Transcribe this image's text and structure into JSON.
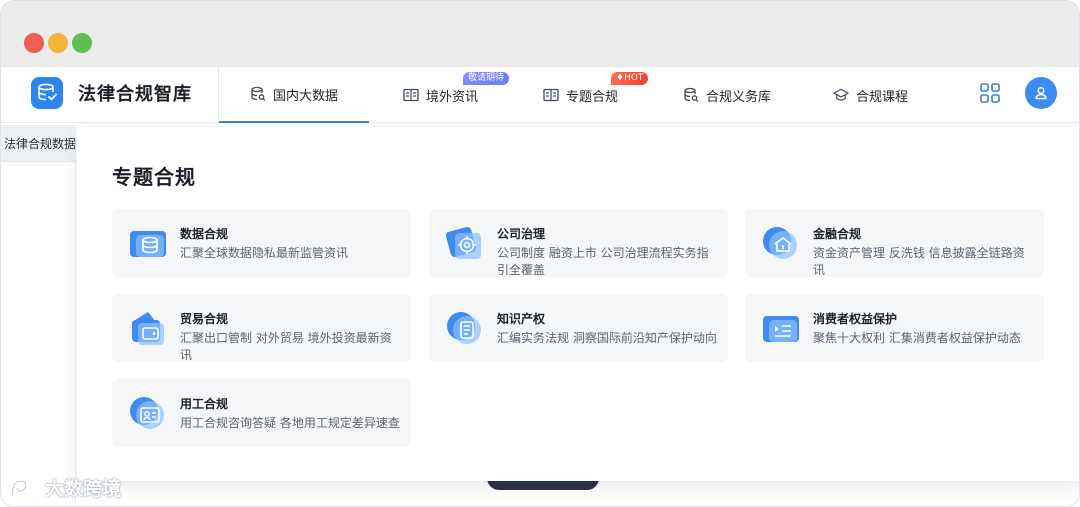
{
  "app": {
    "title": "法律合规智库"
  },
  "nav": {
    "tabs": [
      {
        "label": "国内大数据",
        "icon": "database-search-icon",
        "active": true
      },
      {
        "label": "境外资讯",
        "icon": "book-icon",
        "badge": "敬请期待"
      },
      {
        "label": "专题合规",
        "icon": "book-icon",
        "badge": "HOT"
      },
      {
        "label": "合规义务库",
        "icon": "database-search-icon"
      },
      {
        "label": "合规课程",
        "icon": "graduation-cap-icon"
      }
    ]
  },
  "sidebar": {
    "active_item": "法律合规数据"
  },
  "dropdown": {
    "title": "专题合规",
    "cards": [
      {
        "title": "数据合规",
        "desc": "汇聚全球数据隐私最新监管资讯",
        "icon": "database-icon"
      },
      {
        "title": "公司治理",
        "desc": "公司制度 融资上市 公司治理流程实务指引全覆盖",
        "icon": "target-icon"
      },
      {
        "title": "金融合规",
        "desc": "资金资产管理 反洗钱 信息披露全链路资讯",
        "icon": "bank-icon"
      },
      {
        "title": "贸易合规",
        "desc": "汇聚出口管制 对外贸易 境外投资最新资讯",
        "icon": "wallet-icon"
      },
      {
        "title": "知识产权",
        "desc": "汇编实务法规 洞察国际前沿知产保护动向",
        "icon": "document-icon"
      },
      {
        "title": "消费者权益保护",
        "desc": "聚焦十大权利 汇集消费者权益保护动态",
        "icon": "list-icon"
      },
      {
        "title": "用工合规",
        "desc": "用工合规咨询答疑 各地用工规定差异速查",
        "icon": "id-card-icon"
      }
    ]
  },
  "watermark": {
    "text": "大数跨境"
  },
  "colors": {
    "accent": "#3f7fe0",
    "card_bg": "#f5f6f8",
    "hot_badge": "#f4412d"
  }
}
